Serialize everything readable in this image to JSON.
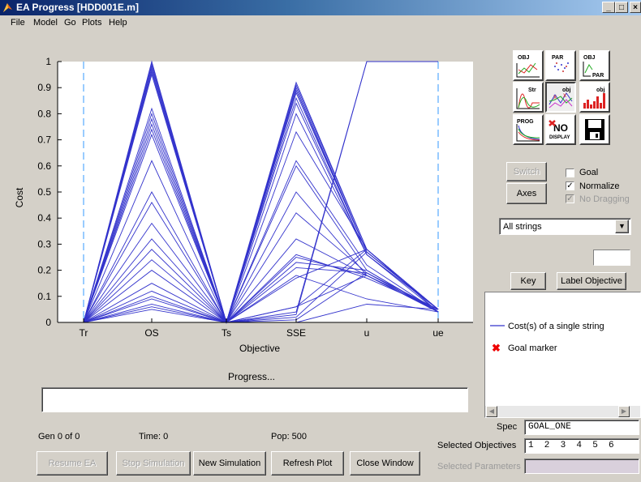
{
  "window": {
    "title": "EA Progress [HDD001E.m]",
    "min": "_",
    "max": "□",
    "close": "×"
  },
  "menu": [
    "File",
    "Model",
    "Go",
    "Plots",
    "Help"
  ],
  "chart_data": {
    "type": "line",
    "categories": [
      "Tr",
      "OS",
      "Ts",
      "SSE",
      "u",
      "ue"
    ],
    "xlabel": "Objective",
    "ylabel": "Cost",
    "ylim": [
      0,
      1
    ],
    "yticks": [
      "0",
      "0.1",
      "0.2",
      "0.3",
      "0.4",
      "0.5",
      "0.6",
      "0.7",
      "0.8",
      "0.9",
      "1"
    ],
    "color": "#3333cc",
    "series": [
      {
        "values": [
          0,
          1.0,
          0,
          0.92,
          0.28,
          0.05
        ]
      },
      {
        "values": [
          0,
          0.99,
          0,
          0.91,
          0.28,
          0.05
        ]
      },
      {
        "values": [
          0,
          0.98,
          0,
          0.9,
          0.27,
          0.05
        ]
      },
      {
        "values": [
          0,
          0.97,
          0,
          0.89,
          0.27,
          0.05
        ]
      },
      {
        "values": [
          0,
          0.96,
          0,
          0.88,
          0.27,
          0.05
        ]
      },
      {
        "values": [
          0,
          0.95,
          0,
          0.86,
          0.26,
          0.05
        ]
      },
      {
        "values": [
          0,
          0.82,
          0,
          0.84,
          0.26,
          0.05
        ]
      },
      {
        "values": [
          0,
          0.8,
          0,
          0.8,
          0.26,
          0.04
        ]
      },
      {
        "values": [
          0,
          0.78,
          0,
          0.73,
          0.28,
          0.04
        ]
      },
      {
        "values": [
          0,
          0.76,
          0,
          0.62,
          0.22,
          0.04
        ]
      },
      {
        "values": [
          0,
          0.74,
          0,
          0.6,
          0.2,
          0.04
        ]
      },
      {
        "values": [
          0,
          0.72,
          0,
          0.5,
          0.18,
          0.05
        ]
      },
      {
        "values": [
          0,
          0.62,
          0,
          0.42,
          0.19,
          0.04
        ]
      },
      {
        "values": [
          0,
          0.5,
          0,
          0.32,
          0.18,
          0.04
        ]
      },
      {
        "values": [
          0,
          0.46,
          0,
          0.26,
          0.17,
          0.05
        ]
      },
      {
        "values": [
          0,
          0.38,
          0,
          0.25,
          0.18,
          0.04
        ]
      },
      {
        "values": [
          0,
          0.32,
          0,
          0.23,
          0.2,
          0.04
        ]
      },
      {
        "values": [
          0,
          0.28,
          0,
          0.21,
          0.19,
          0.05
        ]
      },
      {
        "values": [
          0,
          0.24,
          0,
          0.17,
          0.28,
          0.05
        ]
      },
      {
        "values": [
          0,
          0.2,
          0,
          0.18,
          0.09,
          0.04
        ]
      },
      {
        "values": [
          0,
          0.15,
          0,
          0.06,
          0.18,
          0.04
        ]
      },
      {
        "values": [
          0,
          0.12,
          0,
          0.06,
          0.28,
          0.05
        ]
      },
      {
        "values": [
          0,
          0.1,
          0,
          0.04,
          1.0,
          1.0
        ]
      },
      {
        "values": [
          0,
          0.09,
          0,
          0.03,
          1.0,
          1.0
        ]
      },
      {
        "values": [
          0,
          0.07,
          0,
          0.02,
          0.27,
          0.05
        ]
      },
      {
        "values": [
          0,
          0.06,
          0,
          0.01,
          0.19,
          0.04
        ]
      },
      {
        "values": [
          0,
          0.05,
          0,
          0.0,
          0.07,
          0.05
        ]
      }
    ]
  },
  "progress": {
    "label": "Progress...",
    "value": 0
  },
  "status": {
    "gen": "Gen 0 of 0",
    "time": "Time: 0",
    "pop": "Pop: 500"
  },
  "buttons": {
    "resume": "Resume EA",
    "stop": "Stop Simulation",
    "new_sim": "New Simulation",
    "refresh": "Refresh Plot",
    "close": "Close Window",
    "switch": "Switch",
    "axes": "Axes",
    "key": "Key",
    "label_objective": "Label Objective"
  },
  "toolbar": {
    "obj": "OBJ",
    "par": "PAR",
    "objpar_top": "OBJ",
    "objpar_bottom": "PAR",
    "str": "Str",
    "obj2": "obj",
    "obj3": "obj",
    "prog": "PROG",
    "nodisplay_top": "NO",
    "nodisplay_bottom": "DISPLAY"
  },
  "options": {
    "goal": {
      "label": "Goal",
      "checked": false
    },
    "normalize": {
      "label": "Normalize",
      "checked": true
    },
    "no_dragging": {
      "label": "No Dragging",
      "checked": true,
      "disabled": true
    }
  },
  "dropdown": {
    "value": "All strings",
    "arrow": "▼"
  },
  "legend": {
    "line_label": "Cost(s) of a single string",
    "marker_label": "Goal marker",
    "marker_glyph": "✖"
  },
  "fields": {
    "spec_label": "Spec",
    "spec_value": "GOAL_ONE",
    "sel_obj_label": "Selected Objectives",
    "sel_obj_value": "1  2  3  4  5  6",
    "sel_par_label": "Selected Parameters",
    "sel_par_value": ""
  }
}
